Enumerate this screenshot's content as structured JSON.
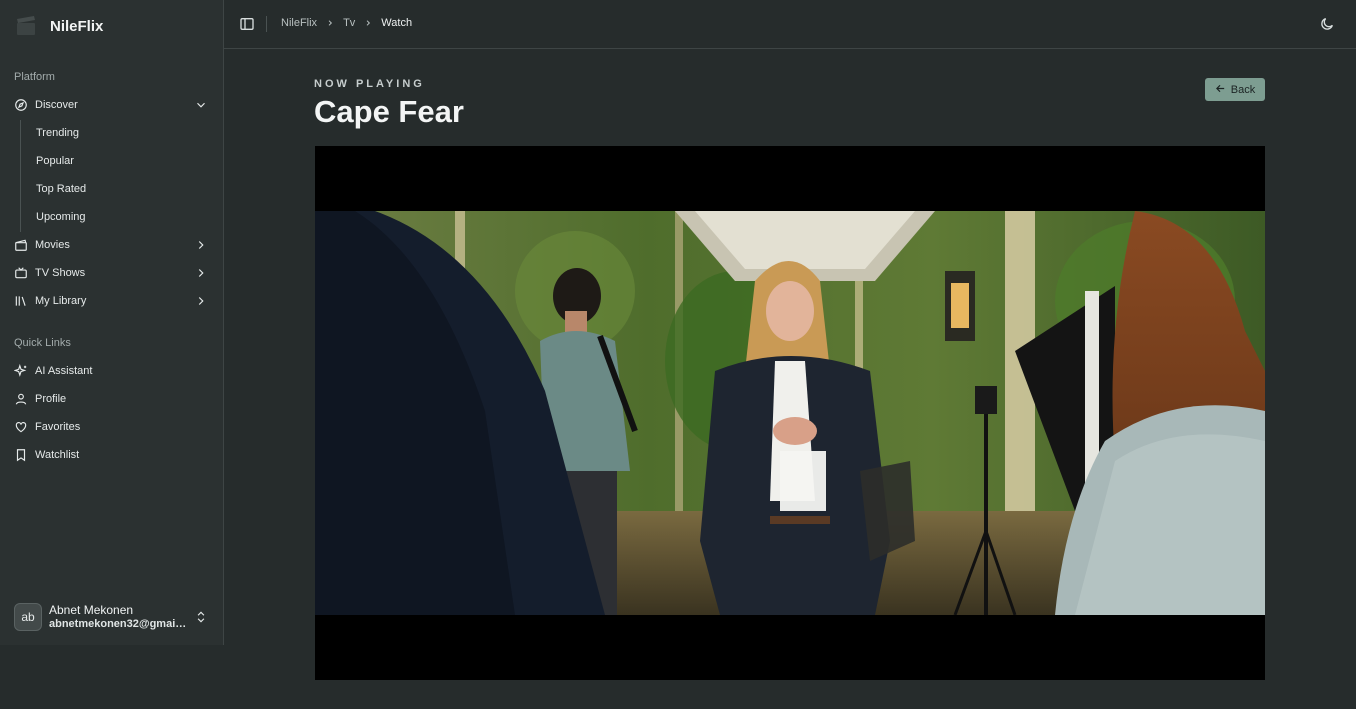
{
  "app": {
    "name": "NileFlix"
  },
  "sidebar": {
    "platform_label": "Platform",
    "discover": {
      "label": "Discover",
      "sub_items": [
        "Trending",
        "Popular",
        "Top Rated",
        "Upcoming"
      ]
    },
    "movies_label": "Movies",
    "tv_label": "TV Shows",
    "library_label": "My Library",
    "quick_links_label": "Quick Links",
    "quick_links": [
      "AI Assistant",
      "Profile",
      "Favorites",
      "Watchlist"
    ],
    "user": {
      "initials": "ab",
      "name": "Abnet Mekonen",
      "email": "abnetmekonen32@gmail.com"
    }
  },
  "header": {
    "breadcrumb": [
      "NileFlix",
      "Tv",
      "Watch"
    ]
  },
  "main": {
    "eyebrow": "NOW PLAYING",
    "title": "Cape Fear",
    "back_label": "Back"
  },
  "colors": {
    "background": "#262c2c",
    "sidebar": "#2b3131",
    "accent": "#7d9d91"
  }
}
